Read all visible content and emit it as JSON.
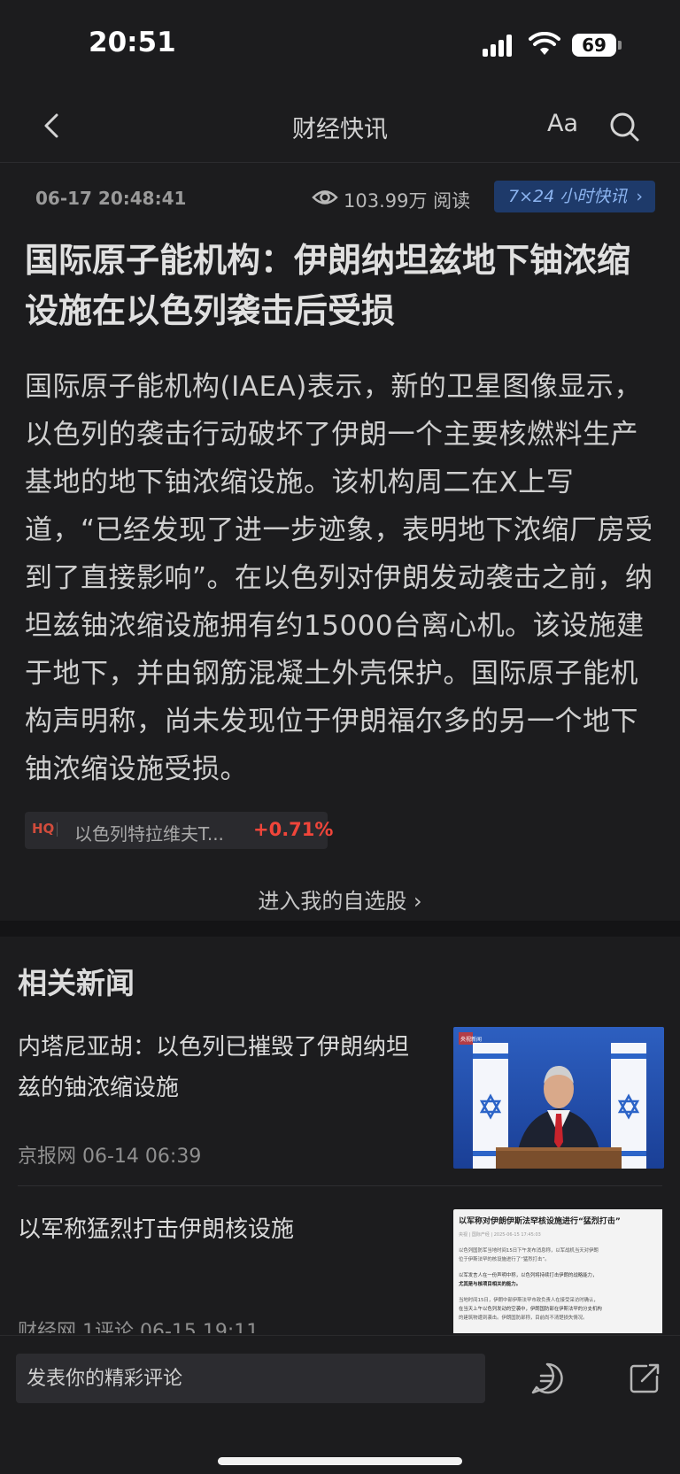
{
  "status_bar": {
    "time": "20:51",
    "battery": "69"
  },
  "nav": {
    "title": "财经快讯",
    "font_button": "Aa"
  },
  "meta": {
    "datetime": "06-17 20:48:41",
    "views": "103.99万 阅读",
    "badge": "7×24 小时快讯"
  },
  "article": {
    "headline": "国际原子能机构：伊朗纳坦兹地下铀浓缩设施在以色列袭击后受损",
    "body": "国际原子能机构(IAEA)表示，新的卫星图像显示，以色列的袭击行动破坏了伊朗一个主要核燃料生产基地的地下铀浓缩设施。该机构周二在X上写道，“已经发现了进一步迹象，表明地下浓缩厂房受到了直接影响”。在以色列对伊朗发动袭击之前，纳坦兹铀浓缩设施拥有约15000台离心机。该设施建于地下，并由钢筋混凝土外壳保护。国际原子能机构声明称，尚未发现位于伊朗福尔多的另一个地下铀浓缩设施受损。"
  },
  "stock": {
    "tag": "HQ",
    "name": "以色列特拉维夫T...",
    "change": "+0.71%"
  },
  "watchlist_link": "进入我的自选股",
  "related": {
    "title": "相关新闻",
    "items": [
      {
        "title": "内塔尼亚胡：以色列已摧毁了伊朗纳坦兹的铀浓缩设施",
        "meta": "京报网  06-14 06:39",
        "thumb_label": "央视新闻"
      },
      {
        "title": "以军称猛烈打击伊朗核设施",
        "meta": "财经网  1评论  06-15 19:11",
        "thumb_heading": "以军称对伊朗伊斯法罕核设施进行“猛烈打击”",
        "thumb_sub": "央视 | 国际产经 | 2025-06-15 17:45:03",
        "thumb_lines": [
          "以色列国防军当地时间15日下午发布消息称，以军战机当天对伊朗",
          "位于伊斯法罕的核设施进行了“猛烈打击”。",
          "以军发言人在一份声明中称，以色列将持续打击伊朗的战略能力，",
          "尤其是与核项目相关的能力。",
          "当地时间15日，伊朗中部伊斯法罕市政负责人在接受采访时确认，",
          "在当天上午以色列发动的空袭中，伊朗国防部在伊斯法罕的分支机构",
          "的建筑物遭到袭击。伊朗国防部称，目前尚不清楚损失情况。"
        ]
      }
    ]
  },
  "comment": {
    "placeholder": "发表你的精彩评论"
  }
}
